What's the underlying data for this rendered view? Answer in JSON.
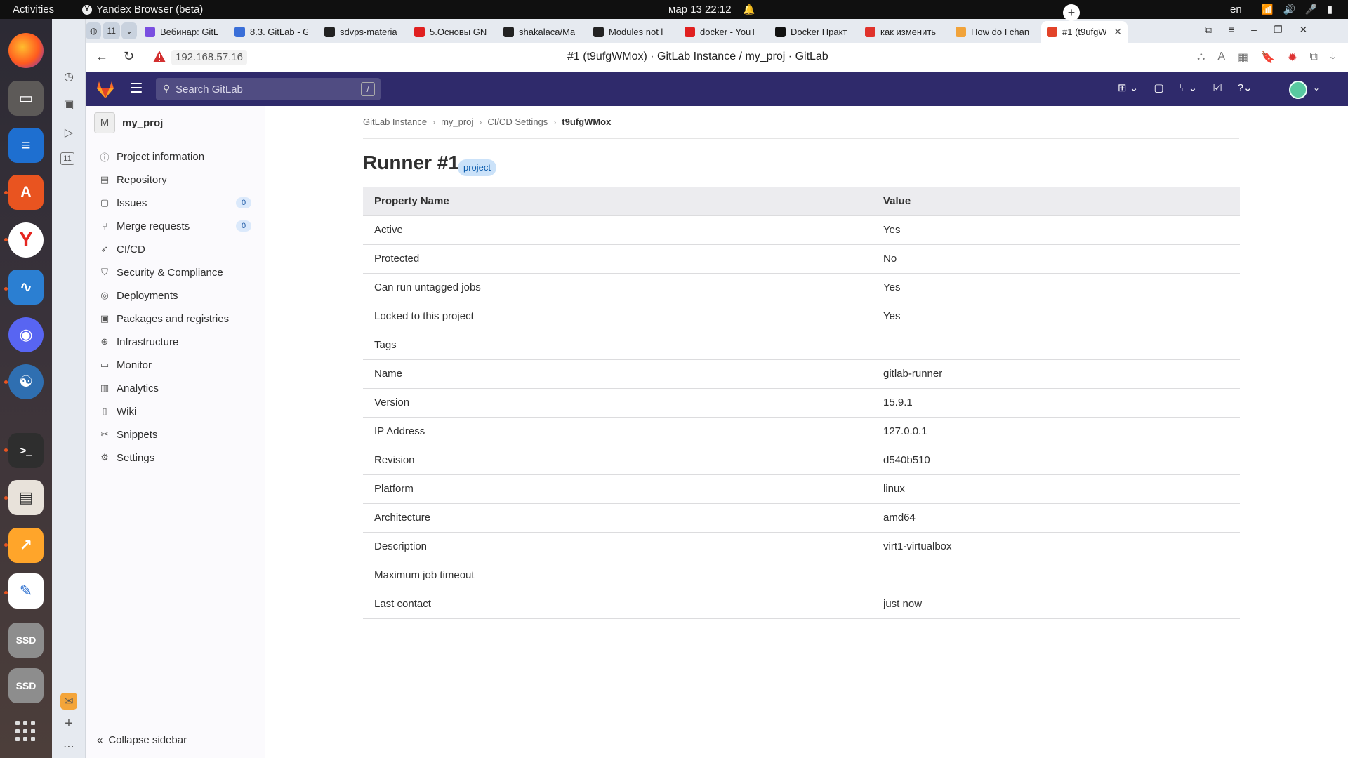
{
  "os_bar": {
    "activities": "Activities",
    "app_name": "Yandex Browser (beta)",
    "clock": "мар 13  22:12",
    "lang": "en"
  },
  "browser": {
    "tab_group_count": "11",
    "tabs": [
      {
        "title": "Вебинар: GitL",
        "color": "#7a4fe0"
      },
      {
        "title": "8.3. GitLab - G",
        "color": "#3a6fd8"
      },
      {
        "title": "sdvps-materia",
        "color": "#222222"
      },
      {
        "title": "5.Основы GN",
        "color": "#e02020"
      },
      {
        "title": "shakalaca/Ma",
        "color": "#222222"
      },
      {
        "title": "Modules not l",
        "color": "#222222"
      },
      {
        "title": "docker - YouT",
        "color": "#e02020"
      },
      {
        "title": "Docker Практ",
        "color": "#111111"
      },
      {
        "title": "как изменить",
        "color": "#e0322b"
      },
      {
        "title": "How do I chan",
        "color": "#f1a33a"
      },
      {
        "title": "#1 (t9ufgW",
        "color": "#e24329"
      }
    ],
    "url": "192.168.57.16",
    "page_title": "#1 (t9ufgWMox) · GitLab Instance / my_proj · GitLab"
  },
  "gitlab": {
    "search_placeholder": "Search GitLab",
    "search_shortcut": "/",
    "accent": "#2f2a6b"
  },
  "sidebar": {
    "project_initial": "M",
    "project_name": "my_proj",
    "items": [
      {
        "label": "Project information",
        "icon": "info-icon"
      },
      {
        "label": "Repository",
        "icon": "document-icon"
      },
      {
        "label": "Issues",
        "icon": "issues-icon",
        "count": "0"
      },
      {
        "label": "Merge requests",
        "icon": "merge-request-icon",
        "count": "0"
      },
      {
        "label": "CI/CD",
        "icon": "rocket-icon"
      },
      {
        "label": "Security & Compliance",
        "icon": "shield-icon"
      },
      {
        "label": "Deployments",
        "icon": "deployments-icon"
      },
      {
        "label": "Packages and registries",
        "icon": "package-icon"
      },
      {
        "label": "Infrastructure",
        "icon": "infrastructure-icon"
      },
      {
        "label": "Monitor",
        "icon": "monitor-icon"
      },
      {
        "label": "Analytics",
        "icon": "chart-icon"
      },
      {
        "label": "Wiki",
        "icon": "book-icon"
      },
      {
        "label": "Snippets",
        "icon": "scissors-icon"
      },
      {
        "label": "Settings",
        "icon": "gear-icon"
      }
    ],
    "collapse_label": "Collapse sidebar"
  },
  "breadcrumbs": [
    "GitLab Instance",
    "my_proj",
    "CI/CD Settings",
    "t9ufgWMox"
  ],
  "runner": {
    "title": "Runner #1",
    "badge": "project",
    "table_headers": [
      "Property Name",
      "Value"
    ],
    "rows": [
      {
        "name": "Active",
        "value": "Yes"
      },
      {
        "name": "Protected",
        "value": "No"
      },
      {
        "name": "Can run untagged jobs",
        "value": "Yes"
      },
      {
        "name": "Locked to this project",
        "value": "Yes"
      },
      {
        "name": "Tags",
        "value": ""
      },
      {
        "name": "Name",
        "value": "gitlab-runner"
      },
      {
        "name": "Version",
        "value": "15.9.1"
      },
      {
        "name": "IP Address",
        "value": "127.0.0.1"
      },
      {
        "name": "Revision",
        "value": "d540b510"
      },
      {
        "name": "Platform",
        "value": "linux"
      },
      {
        "name": "Architecture",
        "value": "amd64"
      },
      {
        "name": "Description",
        "value": "virt1-virtualbox"
      },
      {
        "name": "Maximum job timeout",
        "value": ""
      },
      {
        "name": "Last contact",
        "value": "just now"
      }
    ]
  }
}
